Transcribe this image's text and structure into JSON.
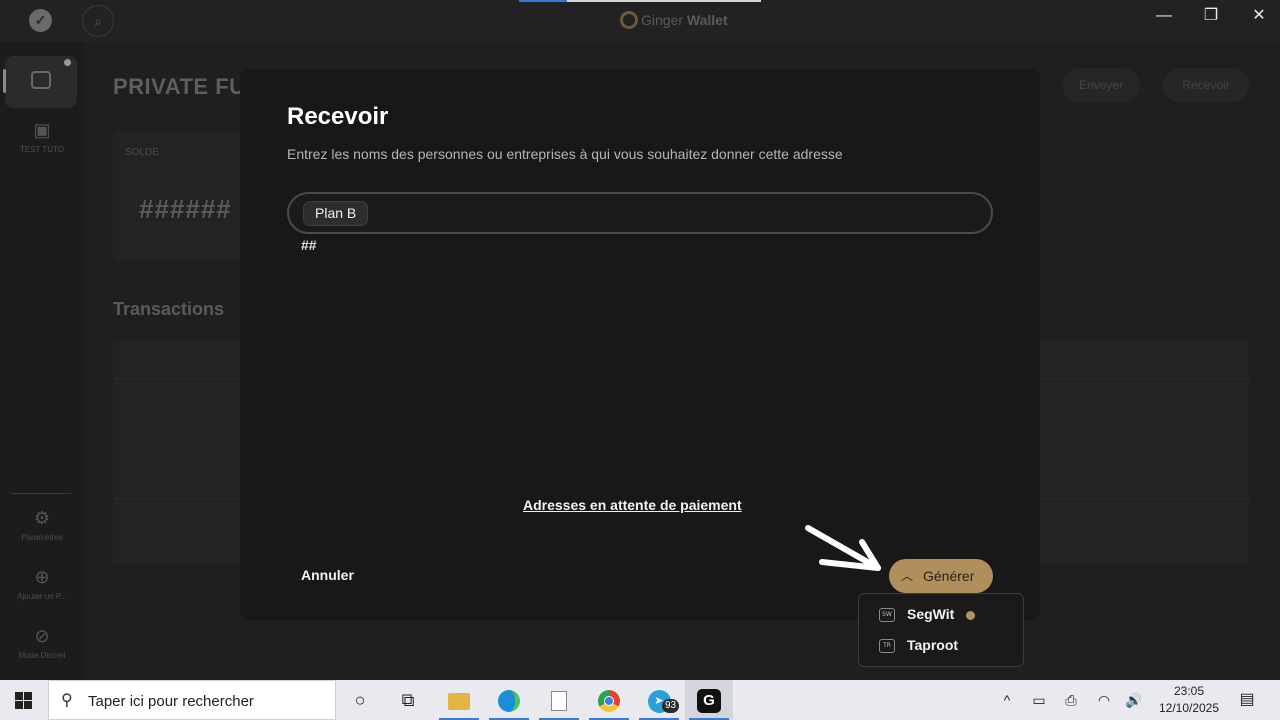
{
  "titlebar": {
    "app_name_light": "Ginger",
    "app_name_bold": "Wallet",
    "minimize": "—",
    "maximize": "❐",
    "close": "✕"
  },
  "sidebar": {
    "items": [
      {
        "label": "TEST TUTO",
        "icon": "wallet-icon"
      },
      {
        "label": "Paramètres",
        "icon": "gear-icon"
      },
      {
        "label": "Ajouter un P...",
        "icon": "add-circle-icon"
      },
      {
        "label": "Mode Discret",
        "icon": "eye-off-icon"
      }
    ]
  },
  "background": {
    "page_title": "PRIVATE FU",
    "balance_label": "SOLDE",
    "balance_value": "######",
    "transactions_title": "Transactions",
    "send_label": "Envoyer",
    "receive_label": "Recevoir"
  },
  "dialog": {
    "title": "Recevoir",
    "subtitle": "Entrez les noms des personnes ou entreprises à qui vous souhaitez donner cette adresse",
    "label_chip": "Plan B",
    "hash_text": "##",
    "pending_link": "Adresses en attente de paiement",
    "cancel_label": "Annuler",
    "generate_label": "Générer"
  },
  "address_menu": {
    "items": [
      {
        "badge": "SW",
        "label": "SegWit",
        "selected": true
      },
      {
        "badge": "TR",
        "label": "Taproot",
        "selected": false
      }
    ]
  },
  "taskbar": {
    "search_placeholder": "Taper ici pour rechercher",
    "telegram_badge": "93",
    "time": "23:05",
    "date": "12/10/2025"
  },
  "colors": {
    "accent": "#b08f5c",
    "dialog_bg": "#181818",
    "taskbar_bg": "#e8eaf0"
  }
}
